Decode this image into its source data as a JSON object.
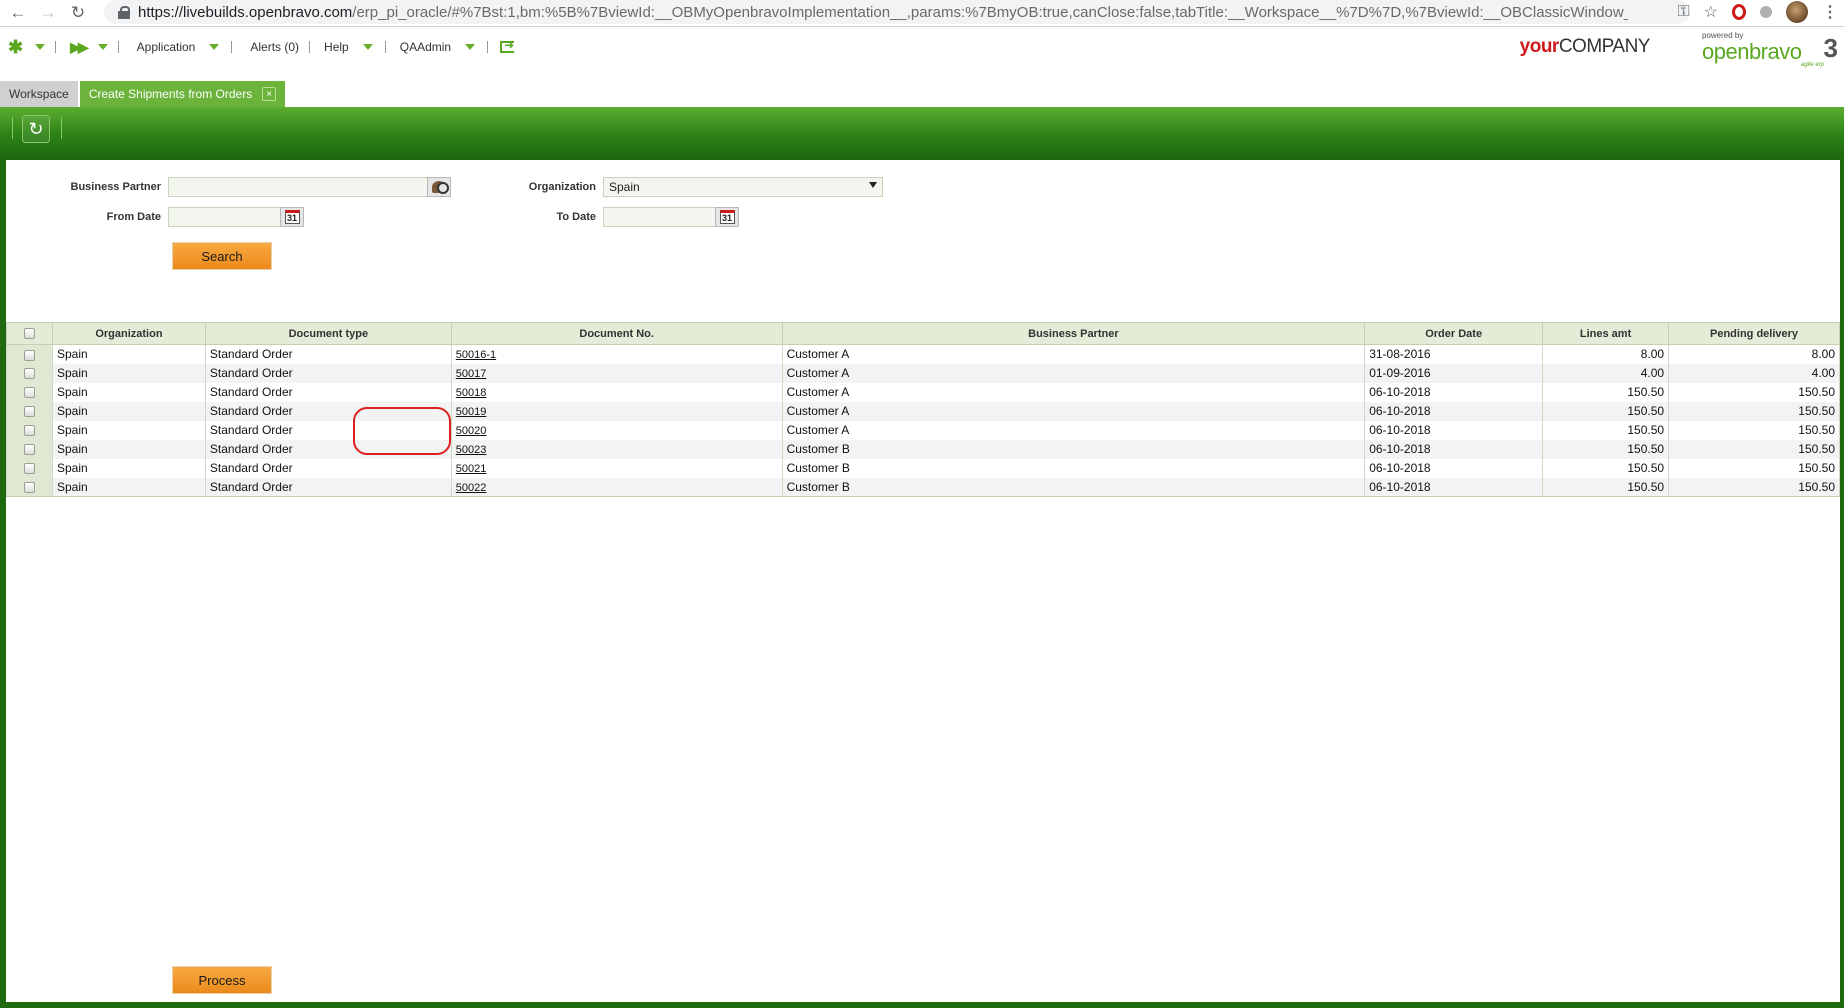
{
  "browser": {
    "url_host": "https://livebuilds.openbravo.com",
    "url_path": "/erp_pi_oracle/#%7Bst:1,bm:%5B%7BviewId:__OBMyOpenbravoImplementation__,params:%7BmyOB:true,canClose:false,tabTitle:__Workspace__%7D%7D,%7BviewId:__OBClassicWindow__,params:..."
  },
  "menu": {
    "application": "Application",
    "alerts": "Alerts (0)",
    "help": "Help",
    "user": "QAAdmin"
  },
  "logo": {
    "company_your": "your",
    "company_name": "COMPANY",
    "powered_by": "powered by",
    "brand": "openbravo",
    "version": "3",
    "tagline": "agile erp"
  },
  "tabs": {
    "workspace": "Workspace",
    "active": "Create Shipments from Orders",
    "close_glyph": "×"
  },
  "form": {
    "business_partner_label": "Business Partner",
    "business_partner_value": "",
    "organization_label": "Organization",
    "organization_value": "Spain",
    "from_date_label": "From Date",
    "from_date_value": "",
    "to_date_label": "To Date",
    "to_date_value": "",
    "calendar_glyph": "31",
    "search_button": "Search"
  },
  "grid": {
    "columns": [
      "Organization",
      "Document type",
      "Document No.",
      "Business Partner",
      "Order Date",
      "Lines amt",
      "Pending delivery"
    ],
    "rows": [
      {
        "org": "Spain",
        "doctype": "Standard Order",
        "docno": "50016-1",
        "bp": "Customer A",
        "date": "31-08-2016",
        "lines": "8.00",
        "pending": "8.00"
      },
      {
        "org": "Spain",
        "doctype": "Standard Order",
        "docno": "50017",
        "bp": "Customer A",
        "date": "01-09-2016",
        "lines": "4.00",
        "pending": "4.00"
      },
      {
        "org": "Spain",
        "doctype": "Standard Order",
        "docno": "50018",
        "bp": "Customer A",
        "date": "06-10-2018",
        "lines": "150.50",
        "pending": "150.50"
      },
      {
        "org": "Spain",
        "doctype": "Standard Order",
        "docno": "50019",
        "bp": "Customer A",
        "date": "06-10-2018",
        "lines": "150.50",
        "pending": "150.50"
      },
      {
        "org": "Spain",
        "doctype": "Standard Order",
        "docno": "50020",
        "bp": "Customer A",
        "date": "06-10-2018",
        "lines": "150.50",
        "pending": "150.50"
      },
      {
        "org": "Spain",
        "doctype": "Standard Order",
        "docno": "50023",
        "bp": "Customer B",
        "date": "06-10-2018",
        "lines": "150.50",
        "pending": "150.50"
      },
      {
        "org": "Spain",
        "doctype": "Standard Order",
        "docno": "50021",
        "bp": "Customer B",
        "date": "06-10-2018",
        "lines": "150.50",
        "pending": "150.50"
      },
      {
        "org": "Spain",
        "doctype": "Standard Order",
        "docno": "50022",
        "bp": "Customer B",
        "date": "06-10-2018",
        "lines": "150.50",
        "pending": "150.50"
      }
    ]
  },
  "process_button": "Process",
  "colors": {
    "brand_green": "#5aa820",
    "toolbar_green": "#2f8418",
    "button_orange": "#ec8a1c",
    "highlight_red": "#dd2020"
  }
}
